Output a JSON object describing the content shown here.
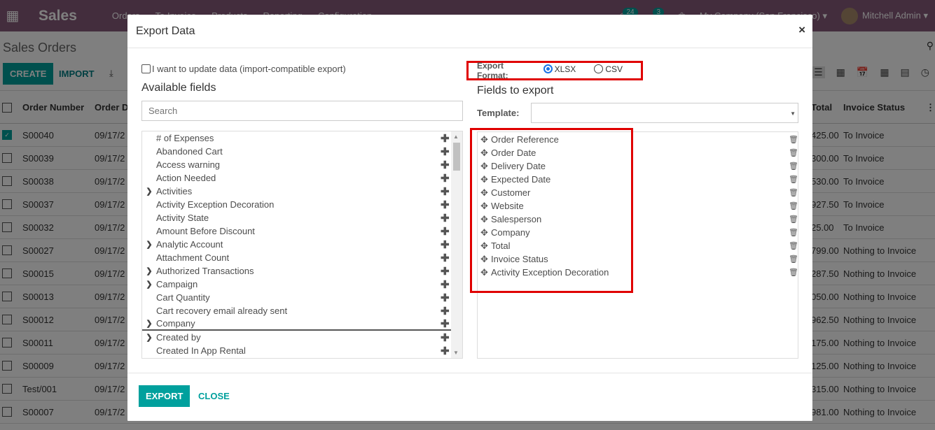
{
  "app": {
    "brand": "Sales",
    "menu": [
      "Orders",
      "To Invoice",
      "Products",
      "Reporting",
      "Configuration"
    ],
    "activity_count": "24",
    "message_count": "3",
    "company": "My Company (San Francisco)",
    "user": "Mitchell Admin"
  },
  "control_panel": {
    "title": "Sales Orders",
    "create_label": "CREATE",
    "import_label": "IMPORT"
  },
  "list": {
    "headers": {
      "number": "Order Number",
      "date": "Order Da",
      "total": "Total",
      "status": "Invoice Status"
    },
    "rows": [
      {
        "number": "S00040",
        "date": "09/17/2",
        "total": "425.00",
        "status": "To Invoice",
        "checked": true
      },
      {
        "number": "S00039",
        "date": "09/17/2",
        "total": "300.00",
        "status": "To Invoice"
      },
      {
        "number": "S00038",
        "date": "09/17/2",
        "total": "530.00",
        "status": "To Invoice"
      },
      {
        "number": "S00037",
        "date": "09/17/2",
        "total": "927.50",
        "status": "To Invoice"
      },
      {
        "number": "S00032",
        "date": "09/17/2",
        "total": "25.00",
        "status": "To Invoice"
      },
      {
        "number": "S00027",
        "date": "09/17/2",
        "total": "799.00",
        "status": "Nothing to Invoice"
      },
      {
        "number": "S00015",
        "date": "09/17/2",
        "total": "287.50",
        "status": "Nothing to Invoice"
      },
      {
        "number": "S00013",
        "date": "09/17/2",
        "total": "050.00",
        "status": "Nothing to Invoice"
      },
      {
        "number": "S00012",
        "date": "09/17/2",
        "total": "962.50",
        "status": "Nothing to Invoice"
      },
      {
        "number": "S00011",
        "date": "09/17/2",
        "total": "175.00",
        "status": "Nothing to Invoice"
      },
      {
        "number": "S00009",
        "date": "09/17/2",
        "total": "125.00",
        "status": "Nothing to Invoice"
      },
      {
        "number": "Test/001",
        "date": "09/17/2",
        "total": "315.00",
        "status": "Nothing to Invoice"
      },
      {
        "number": "S00007",
        "date": "09/17/2",
        "total": "981.00",
        "status": "Nothing to Invoice"
      }
    ]
  },
  "modal": {
    "title": "Export Data",
    "close_symbol": "×",
    "import_compat_label": "I want to update data (import-compatible export)",
    "available_title": "Available fields",
    "search_placeholder": "Search",
    "available_fields": [
      {
        "name": "# of Expenses",
        "expandable": false
      },
      {
        "name": "Abandoned Cart",
        "expandable": false
      },
      {
        "name": "Access warning",
        "expandable": false
      },
      {
        "name": "Action Needed",
        "expandable": false
      },
      {
        "name": "Activities",
        "expandable": true
      },
      {
        "name": "Activity Exception Decoration",
        "expandable": false
      },
      {
        "name": "Activity State",
        "expandable": false
      },
      {
        "name": "Amount Before Discount",
        "expandable": false
      },
      {
        "name": "Analytic Account",
        "expandable": true
      },
      {
        "name": "Attachment Count",
        "expandable": false
      },
      {
        "name": "Authorized Transactions",
        "expandable": true
      },
      {
        "name": "Campaign",
        "expandable": true
      },
      {
        "name": "Cart Quantity",
        "expandable": false
      },
      {
        "name": "Cart recovery email already sent",
        "expandable": false
      },
      {
        "name": "Company",
        "expandable": true,
        "selected": true
      },
      {
        "name": "Created by",
        "expandable": true
      },
      {
        "name": "Created In App Rental",
        "expandable": false
      }
    ],
    "export_format_label": "Export Format:",
    "formats": [
      {
        "label": "XLSX",
        "selected": true
      },
      {
        "label": "CSV",
        "selected": false
      }
    ],
    "fields_to_export_title": "Fields to export",
    "template_label": "Template:",
    "template_value": "",
    "export_fields": [
      "Order Reference",
      "Order Date",
      "Delivery Date",
      "Expected Date",
      "Customer",
      "Website",
      "Salesperson",
      "Company",
      "Total",
      "Invoice Status",
      "Activity Exception Decoration"
    ],
    "export_button": "EXPORT",
    "close_button": "CLOSE"
  },
  "colors": {
    "brand": "#875a7b",
    "primary": "#00a09d",
    "highlight": "#e00000",
    "radio": "#1a73e8"
  }
}
